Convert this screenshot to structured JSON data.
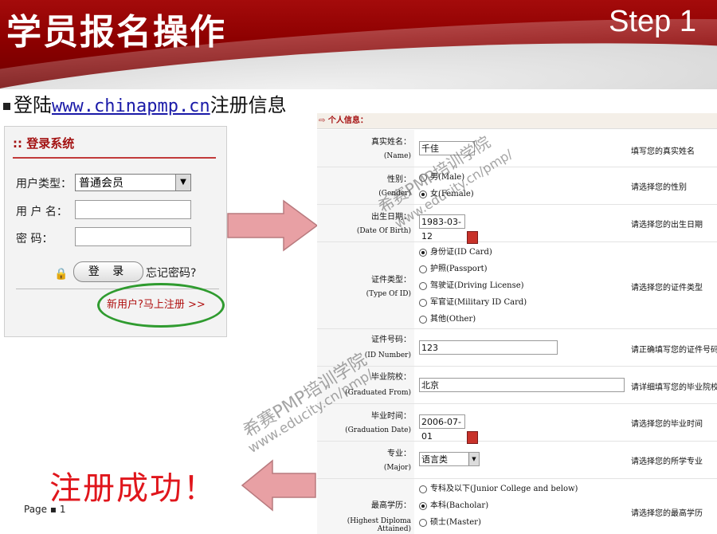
{
  "slide": {
    "title": "学员报名操作",
    "step": "Step 1",
    "bullet_prefix": "登陆",
    "bullet_link": "www.chinapmp.cn",
    "bullet_suffix": "注册信息",
    "success_text": "注册成功！",
    "page_label": "Page ▪ 1"
  },
  "login": {
    "header": ":: 登录系统",
    "user_type_label": "用户类型：",
    "user_type_value": "普通会员",
    "username_label": "用 户 名：",
    "password_label": "密    码：",
    "login_button": "登 录",
    "forgot_link": "忘记密码?",
    "new_user_link": "新用户?马上注册 >>"
  },
  "form": {
    "section_header": "⇨ 个人信息：",
    "name": {
      "label_cn": "真实姓名：",
      "label_en": "(Name)",
      "value": "千佳",
      "hint": "填写您的真实姓名"
    },
    "gender": {
      "label_cn": "性别：",
      "label_en": "(Gender)",
      "options": [
        "男(Male)",
        "女(Female)"
      ],
      "hint": "请选择您的性别"
    },
    "birth": {
      "label_cn": "出生日期：",
      "label_en": "(Date Of Birth)",
      "value": "1983-03-12",
      "hint": "请选择您的出生日期"
    },
    "id_type": {
      "label_cn": "证件类型：",
      "label_en": "(Type Of ID)",
      "options": [
        "身份证(ID Card)",
        "护照(Passport)",
        "驾驶证(Driving License)",
        "军官证(Military ID Card)",
        "其他(Other)"
      ],
      "hint": "请选择您的证件类型"
    },
    "id_number": {
      "label_cn": "证件号码：",
      "label_en": "(ID Number)",
      "value": "123",
      "hint": "请正确填写您的证件号码"
    },
    "school": {
      "label_cn": "毕业院校：",
      "label_en": "(Graduated From)",
      "value": "北京",
      "hint": "请详细填写您的毕业院校"
    },
    "grad_date": {
      "label_cn": "毕业时间：",
      "label_en": "(Graduation Date)",
      "value": "2006-07-01",
      "hint": "请选择您的毕业时间"
    },
    "major": {
      "label_cn": "专业：",
      "label_en": "(Major)",
      "value": "语言类",
      "hint": "请选择您的所学专业"
    },
    "degree": {
      "label_cn": "最高学历：",
      "label_en": "(Highest Diploma Attained)",
      "options": [
        "专科及以下(Junior College and below)",
        "本科(Bacholar)",
        "硕士(Master)"
      ],
      "hint": "请选择您的最高学历"
    }
  },
  "watermark": {
    "line1": "希赛PMP培训学院",
    "line2": "www.educity.cn/pmp/"
  },
  "colors": {
    "banner_red": "#8d0000",
    "success_red": "#e0161c",
    "arrow_pink": "#e8a0a4",
    "oval_green": "#2f9b2f"
  }
}
